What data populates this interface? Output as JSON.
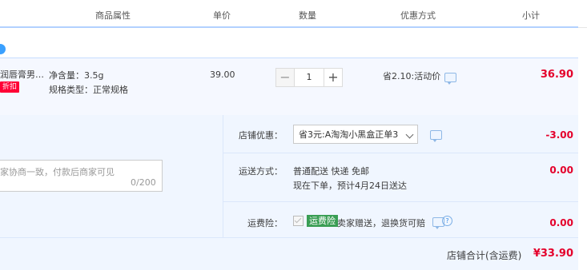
{
  "header": {
    "col_props": "商品属性",
    "col_price": "单价",
    "col_qty": "数量",
    "col_promo": "优惠方式",
    "col_subtotal": "小计"
  },
  "item": {
    "title": "润唇膏男…",
    "discount_tag": "折扣",
    "sku_net": "净含量：3.5g",
    "sku_type": "规格类型：正常规格",
    "price": "39.00",
    "qty": "1",
    "qty_minus": "−",
    "qty_plus": "+",
    "promo": "省2.10:活动价",
    "subtotal": "36.90"
  },
  "message": {
    "placeholder": "家协商一致，付款后商家可见",
    "counter": "0/200"
  },
  "shop_discount": {
    "label": "店铺优惠：",
    "selected": "省3元:A淘淘小黑盒正单3",
    "amount": "-3.00"
  },
  "shipping": {
    "label": "运送方式：",
    "method": "普通配送 快递 免邮",
    "eta": "现在下单，预计4月24日送达",
    "amount": "0.00"
  },
  "insurance": {
    "label": "运费险：",
    "tag": "运费险",
    "desc": "卖家赠送，退换货可赔",
    "help": "?",
    "amount": "0.00"
  },
  "total": {
    "label": "店铺合计(含运费)",
    "value": "¥33.90"
  },
  "colors": {
    "accent_red": "#e4002b",
    "header_rule": "#b2d1ff",
    "panel_bg": "#f0f6ff",
    "insure_green": "#3a9e54"
  }
}
